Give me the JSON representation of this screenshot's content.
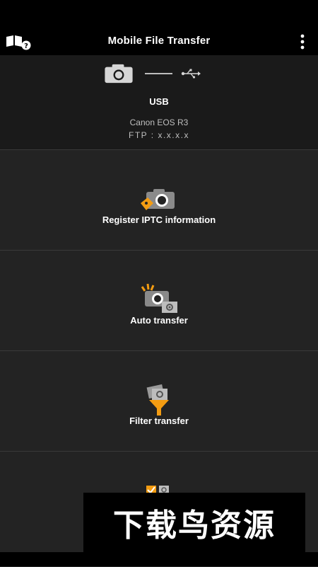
{
  "app": {
    "title": "Mobile File Transfer"
  },
  "connection": {
    "type": "USB",
    "camera_model": "Canon EOS R3",
    "ftp": "FTP : x.x.x.x"
  },
  "menu_items": [
    {
      "label": "Register IPTC information",
      "icon": "camera-tag-icon"
    },
    {
      "label": "Auto transfer",
      "icon": "auto-transfer-icon"
    },
    {
      "label": "Filter transfer",
      "icon": "filter-transfer-icon"
    },
    {
      "label": "",
      "icon": "checklist-icon"
    }
  ],
  "watermark": {
    "text": "下载鸟资源"
  },
  "colors": {
    "accent": "#f39c12",
    "background": "#222222",
    "header": "#000000"
  }
}
